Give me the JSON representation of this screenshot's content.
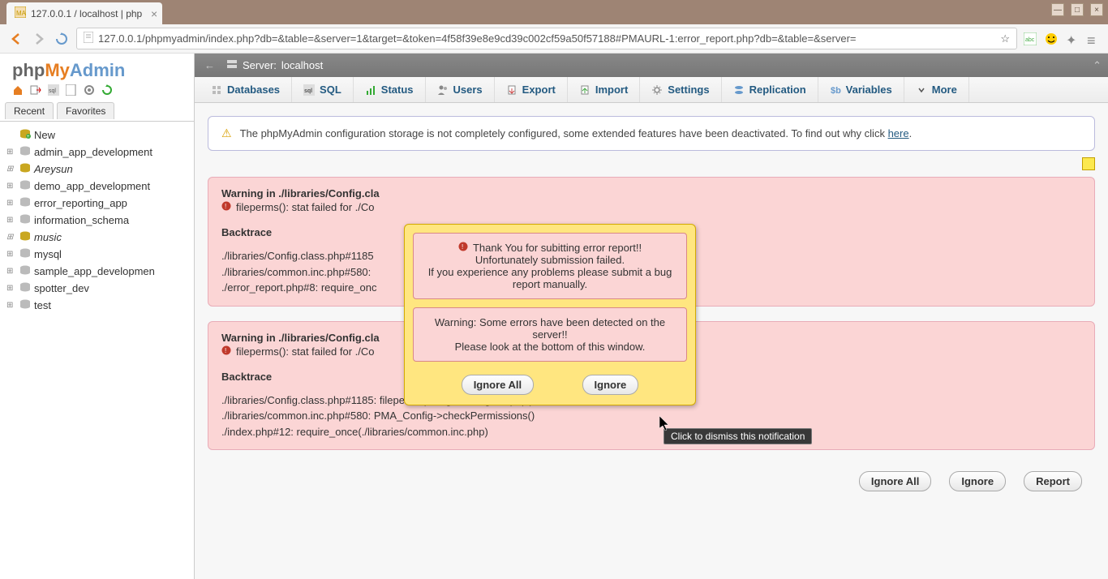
{
  "browser": {
    "tab_title": "127.0.0.1 / localhost | php",
    "url": "127.0.0.1/phpmyadmin/index.php?db=&table=&server=1&target=&token=4f58f39e8e9cd39c002cf59a50f57188#PMAURL-1:error_report.php?db=&table=&server="
  },
  "logo": {
    "php": "php",
    "my": "My",
    "admin": "Admin"
  },
  "sidebar_tabs": {
    "recent": "Recent",
    "favorites": "Favorites"
  },
  "tree": {
    "new": "New",
    "items": [
      {
        "name": "admin_app_development",
        "italic": false
      },
      {
        "name": "Areysun",
        "italic": true
      },
      {
        "name": "demo_app_development",
        "italic": false
      },
      {
        "name": "error_reporting_app",
        "italic": false
      },
      {
        "name": "information_schema",
        "italic": false
      },
      {
        "name": "music",
        "italic": true
      },
      {
        "name": "mysql",
        "italic": false
      },
      {
        "name": "sample_app_developmen",
        "italic": false
      },
      {
        "name": "spotter_dev",
        "italic": false
      },
      {
        "name": "test",
        "italic": false
      }
    ]
  },
  "breadcrumb": {
    "server_label": "Server:",
    "server_value": "localhost"
  },
  "nav_tabs": [
    "Databases",
    "SQL",
    "Status",
    "Users",
    "Export",
    "Import",
    "Settings",
    "Replication",
    "Variables",
    "More"
  ],
  "notice": {
    "text_before": "The phpMyAdmin configuration storage is not completely configured, some extended features have been deactivated. To find out why click ",
    "link": "here",
    "text_after": "."
  },
  "warnings": [
    {
      "heading_label": "Warning",
      "heading_in": " in ",
      "heading_path": "./libraries/Config.cla",
      "sub": "fileperms(): stat failed for ./Co",
      "backtrace_label": "Backtrace",
      "trace": [
        "./libraries/Config.class.php#1185",
        "./libraries/common.inc.php#580:",
        "./error_report.php#8: require_onc"
      ]
    },
    {
      "heading_label": "Warning",
      "heading_in": " in ",
      "heading_path": "./libraries/Config.cla",
      "sub": "fileperms(): stat failed for ./Co",
      "backtrace_label": "Backtrace",
      "trace": [
        "./libraries/Config.class.php#1185: fileperms(string './config.inc.php')",
        "./libraries/common.inc.php#580: PMA_Config->checkPermissions()",
        "./index.php#12: require_once(./libraries/common.inc.php)"
      ]
    }
  ],
  "modal": {
    "box1_line1": "Thank You for subitting error report!!",
    "box1_line2": "Unfortunately submission failed.",
    "box1_line3": "If you experience any problems please submit a bug report manually.",
    "box2_line1": "Warning: Some errors have been detected on the server!!",
    "box2_line2": "Please look at the bottom of this window.",
    "btn_ignore_all": "Ignore All",
    "btn_ignore": "Ignore"
  },
  "bottom_buttons": {
    "ignore_all": "Ignore All",
    "ignore": "Ignore",
    "report": "Report"
  },
  "tooltip": "Click to dismiss this notification"
}
